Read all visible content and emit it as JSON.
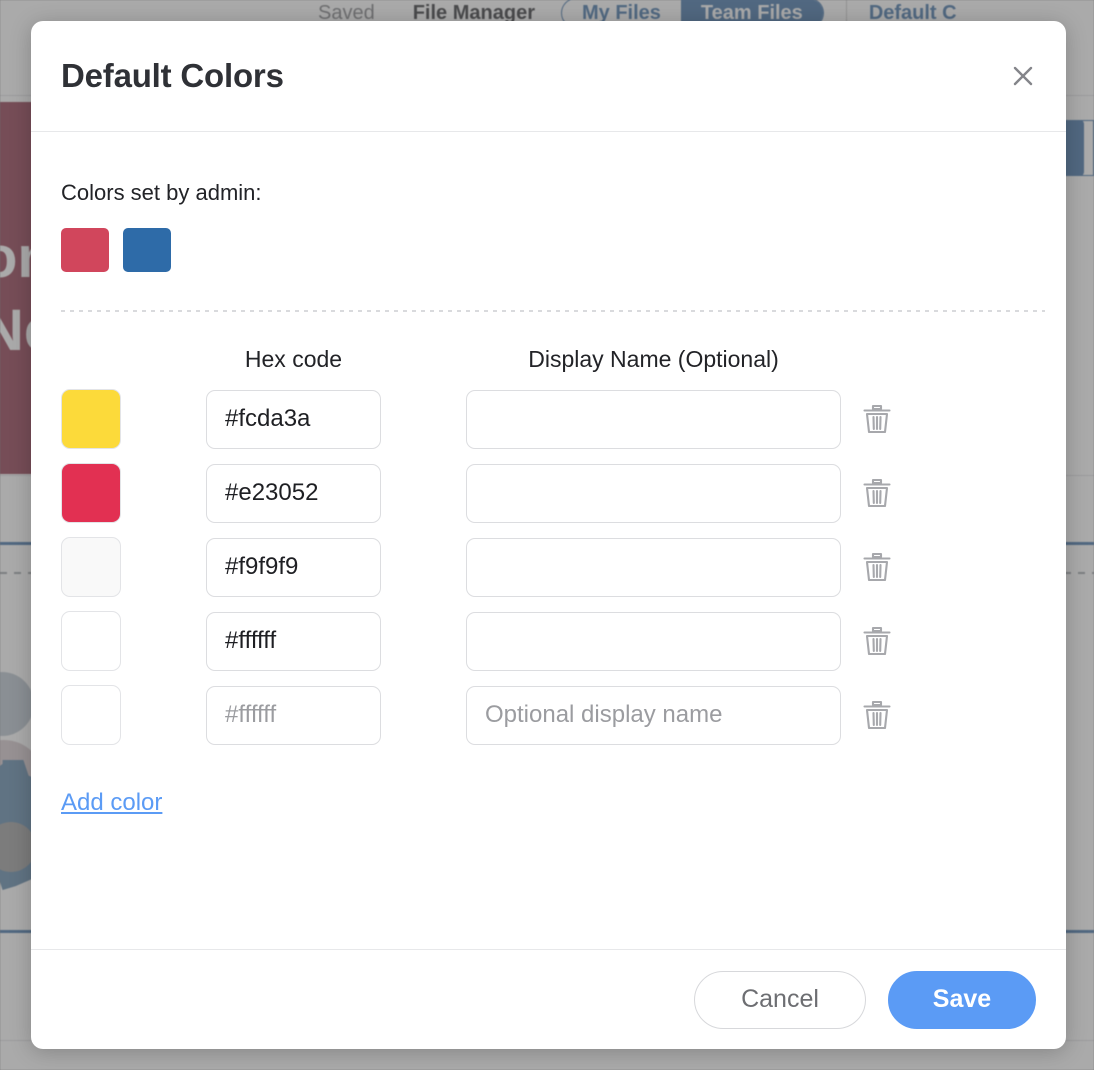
{
  "background": {
    "topbar": {
      "saved_label": "Saved",
      "file_manager_label": "File Manager",
      "segment": [
        {
          "label": "My Files",
          "active": false
        },
        {
          "label": "Team Files",
          "active": true
        }
      ],
      "default_colors_label": "Default C"
    },
    "banner": {
      "line1": "on",
      "line2": "Ne"
    },
    "accent_blue": "#3a6ea5",
    "banner_maroon": "#8c3247",
    "gear_blue": "#5b85a8"
  },
  "modal": {
    "title": "Default Colors",
    "close_icon": "close-icon",
    "admin": {
      "label": "Colors set by admin:",
      "swatches": [
        {
          "hex": "#d1465c",
          "name": "admin-swatch-red"
        },
        {
          "hex": "#2e6ba8",
          "name": "admin-swatch-blue"
        }
      ]
    },
    "columns": {
      "hex_header": "Hex code",
      "name_header": "Display Name (Optional)"
    },
    "rows": [
      {
        "swatch": "#fcda3a",
        "hex_value": "#fcda3a",
        "hex_placeholder": "#ffffff",
        "hex_is_placeholder": false,
        "name_value": "",
        "name_placeholder": "",
        "delete_icon": "trash-icon"
      },
      {
        "swatch": "#e23052",
        "hex_value": "#e23052",
        "hex_placeholder": "#ffffff",
        "hex_is_placeholder": false,
        "name_value": "",
        "name_placeholder": "",
        "delete_icon": "trash-icon"
      },
      {
        "swatch": "#f9f9f9",
        "hex_value": "#f9f9f9",
        "hex_placeholder": "#ffffff",
        "hex_is_placeholder": false,
        "name_value": "",
        "name_placeholder": "",
        "delete_icon": "trash-icon"
      },
      {
        "swatch": "#ffffff",
        "hex_value": "#ffffff",
        "hex_placeholder": "#ffffff",
        "hex_is_placeholder": false,
        "name_value": "",
        "name_placeholder": "",
        "delete_icon": "trash-icon"
      },
      {
        "swatch": "#ffffff",
        "hex_value": "",
        "hex_placeholder": "#ffffff",
        "hex_is_placeholder": true,
        "name_value": "",
        "name_placeholder": "Optional display name",
        "delete_icon": "trash-icon"
      }
    ],
    "add_color_label": "Add color",
    "footer": {
      "cancel_label": "Cancel",
      "save_label": "Save"
    },
    "accent_link": "#5b9bf5",
    "save_bg": "#5b9bf5"
  }
}
